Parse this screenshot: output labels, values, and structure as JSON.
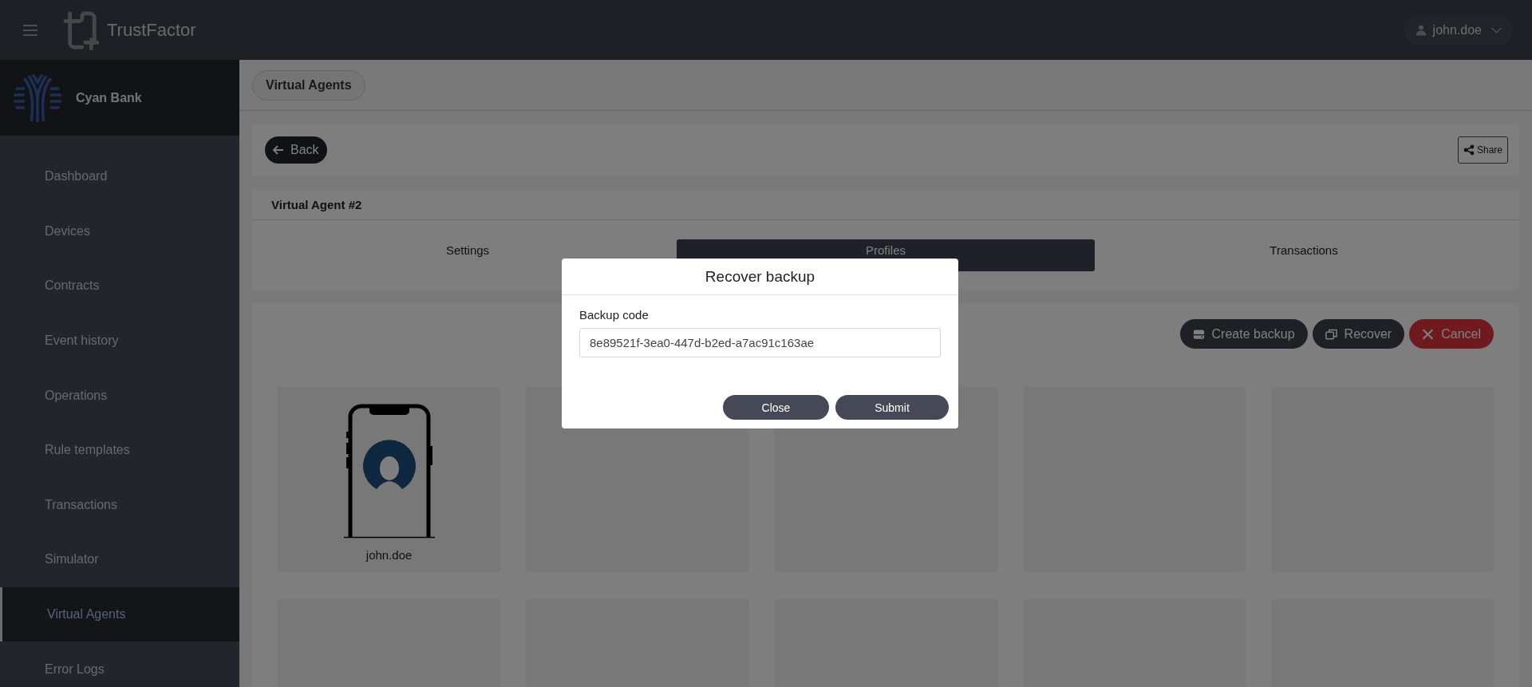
{
  "app": {
    "name": "TrustFactor",
    "user": "john.doe"
  },
  "org": {
    "name": "Cyan Bank"
  },
  "sidebar": {
    "items": [
      {
        "label": "Dashboard",
        "selected": false
      },
      {
        "label": "Devices",
        "selected": false
      },
      {
        "label": "Contracts",
        "selected": false
      },
      {
        "label": "Event history",
        "selected": false
      },
      {
        "label": "Operations",
        "selected": false
      },
      {
        "label": "Rule templates",
        "selected": false
      },
      {
        "label": "Transactions",
        "selected": false
      },
      {
        "label": "Simulator",
        "selected": false
      },
      {
        "label": "Virtual Agents",
        "selected": true
      },
      {
        "label": "Error Logs",
        "selected": false
      }
    ]
  },
  "breadcrumb": "Virtual Agents",
  "back_button": "Back",
  "share_button": "Share",
  "agent": {
    "title": "Virtual Agent #2"
  },
  "tabs": [
    {
      "label": "Settings",
      "selected": false
    },
    {
      "label": "Profiles",
      "selected": true
    },
    {
      "label": "Transactions",
      "selected": false
    }
  ],
  "actions": [
    {
      "label": "Create backup",
      "kind": "backup"
    },
    {
      "label": "Recover",
      "kind": "recover"
    },
    {
      "label": "Cancel",
      "kind": "cancel"
    }
  ],
  "profiles": [
    {
      "kind": "profile",
      "name": "john.doe"
    },
    {
      "kind": "empty"
    },
    {
      "kind": "empty"
    },
    {
      "kind": "empty"
    },
    {
      "kind": "empty"
    },
    {
      "kind": "empty"
    },
    {
      "kind": "empty"
    },
    {
      "kind": "empty"
    },
    {
      "kind": "empty"
    },
    {
      "kind": "empty"
    }
  ],
  "modal": {
    "title": "Recover backup",
    "field_label": "Backup code",
    "value": "8e89521f-3ea0-447d-b2ed-a7ac91c163ae",
    "buttons": [
      "Close",
      "Submit"
    ]
  }
}
